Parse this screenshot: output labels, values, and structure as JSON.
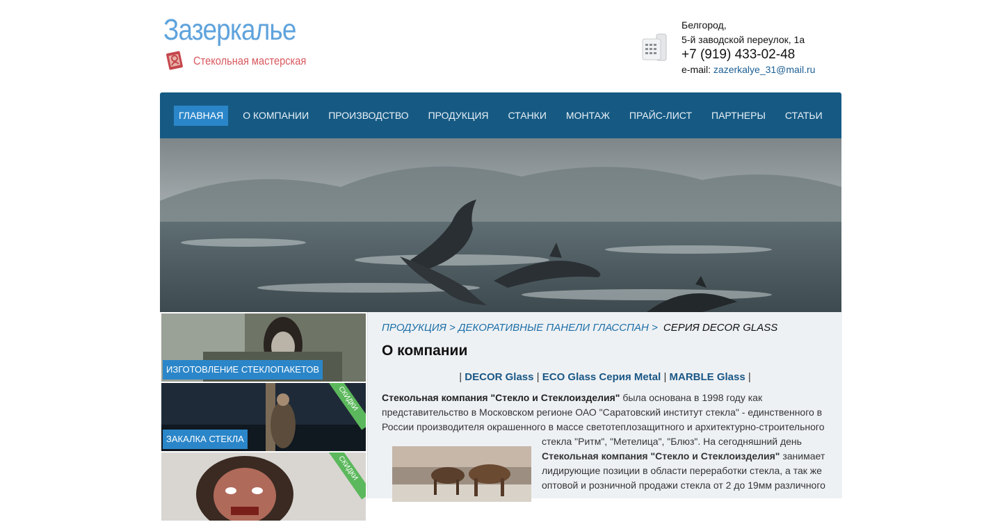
{
  "header": {
    "logo_title": "Зазеркалье",
    "logo_subtitle": "Стекольная мастерская",
    "city": "Белгород,",
    "address": "5-й заводской переулок, 1а",
    "phone": "+7 (919) 433-02-48",
    "email_label": "e-mail:",
    "email": "zazerkalye_31@mail.ru"
  },
  "nav": {
    "items": [
      {
        "label": "ГЛАВНАЯ"
      },
      {
        "label": "О КОМПАНИИ"
      },
      {
        "label": "ПРОИЗВОДСТВО"
      },
      {
        "label": "ПРОДУКЦИЯ"
      },
      {
        "label": "СТАНКИ"
      },
      {
        "label": "МОНТАЖ"
      },
      {
        "label": "ПРАЙС-ЛИСТ"
      },
      {
        "label": "ПАРТНЕРЫ"
      },
      {
        "label": "СТАТЬИ"
      }
    ],
    "active_index": 0
  },
  "sidebar": {
    "tiles": [
      {
        "label": "ИЗГОТОВЛЕНИЕ СТЕКЛОПАКЕТОВ",
        "ribbon": ""
      },
      {
        "label": "ЗАКАЛКА СТЕКЛА",
        "ribbon": "СКИДКИ"
      },
      {
        "label": "",
        "ribbon": "СКИДКИ"
      }
    ]
  },
  "breadcrumb": {
    "items": [
      "ПРОДУКЦИЯ >",
      "ДЕКОРАТИВНЫЕ ПАНЕЛИ ГЛАССПАН >"
    ],
    "current": "СЕРИЯ DECOR GLASS"
  },
  "content": {
    "title": "О компании",
    "series_sep": "|",
    "series": [
      "DECOR Glass",
      "ECO Glass Серия Metal",
      "MARBLE Glass"
    ],
    "p1_bold": "Стекольная компания \"Стекло и Стеклоизделия\"",
    "p1_rest": " была основана в 1998 году как представительство в Московском регионе ОАО \"Саратовский институт стекла\" - единственного в России производителя окрашенного в массе светотеплозащитного и архитектурно-строительного",
    "p2_start": "стекла \"Ритм\", \"Метелица\", \"Блюз\". На сегодняшний день ",
    "p2_bold": "Стекольная компания \"Стекло и Стеклоизделия\"",
    "p2_rest": " занимает лидирующие позиции в области переработки стекла, а так же оптовой и розничной продажи стекла от 2 до 19мм различного"
  },
  "colors": {
    "nav_bg": "#165a84",
    "nav_active": "#2b86c9",
    "logo_blue": "#5fa3dc",
    "logo_red": "#d8595f",
    "ribbon_green": "#5cb85c",
    "link": "#1d6fa8"
  }
}
